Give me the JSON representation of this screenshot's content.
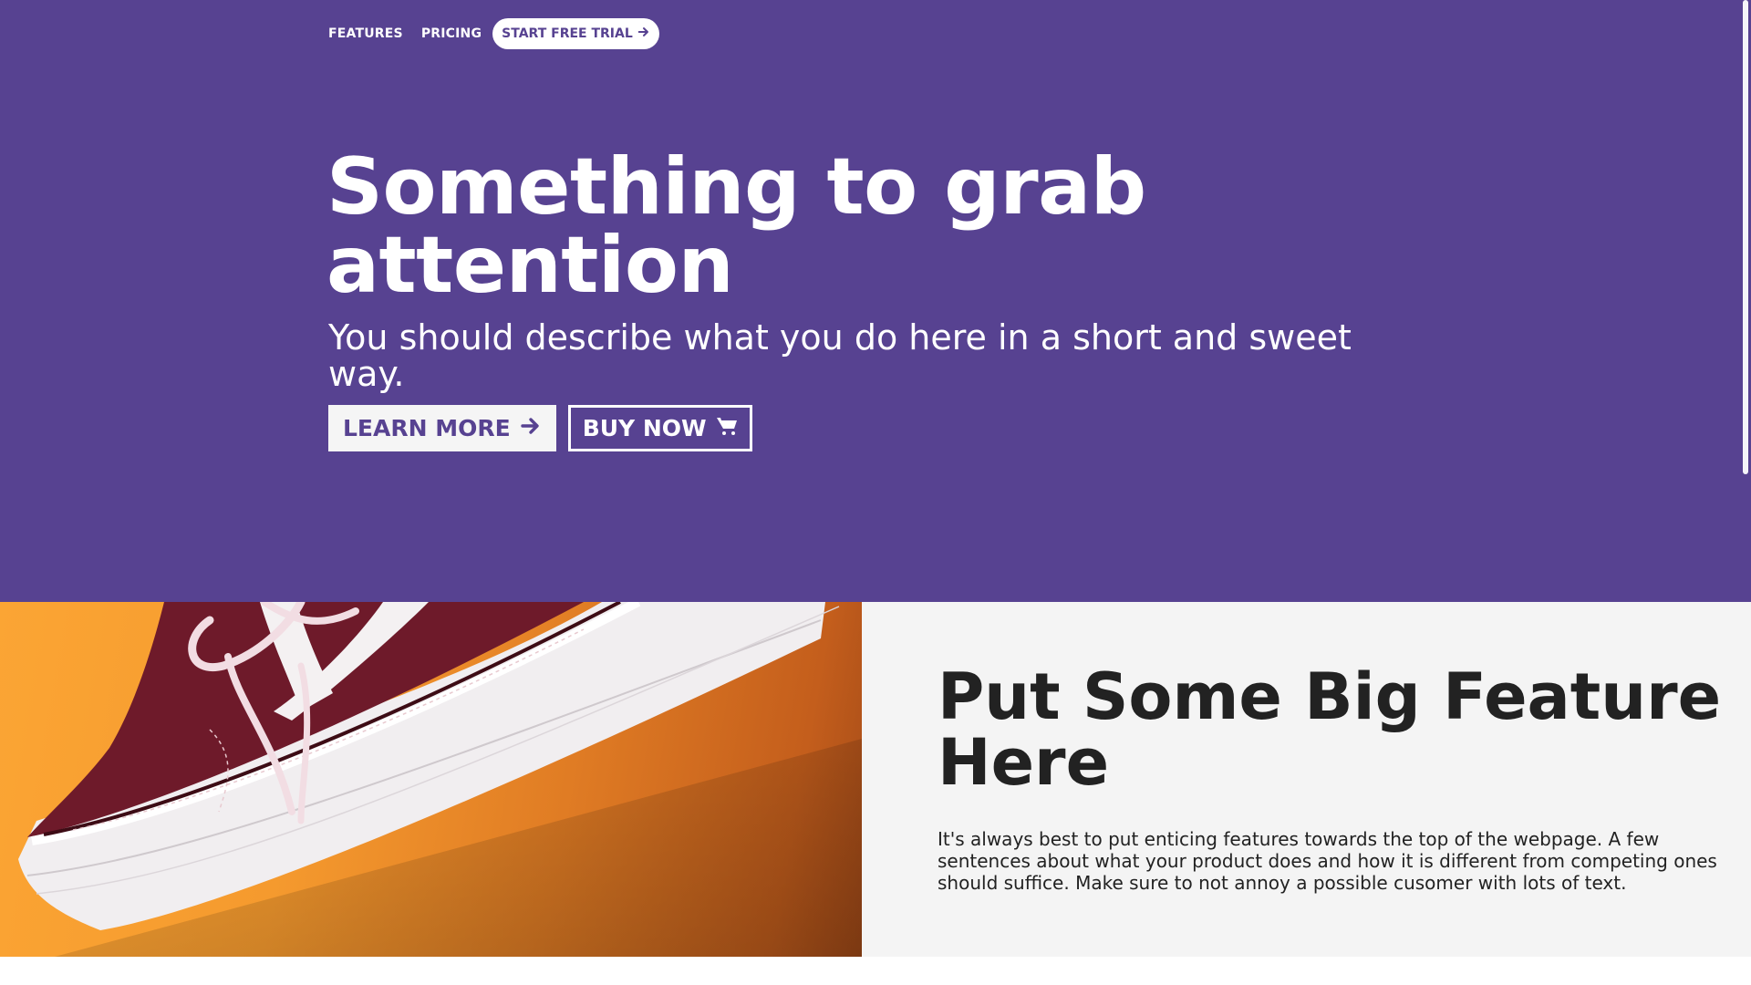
{
  "nav": {
    "features": "FEATURES",
    "pricing": "PRICING",
    "cta": "START FREE TRIAL",
    "cta_icon": "arrow-right-icon"
  },
  "hero": {
    "title": "Something to grab attention",
    "subtitle": "You should describe what you do here in a short and sweet way.",
    "learn_more": "LEARN MORE",
    "learn_more_icon": "arrow-right-icon",
    "buy_now": "BUY NOW",
    "buy_now_icon": "shopping-cart-icon"
  },
  "feature": {
    "title": "Put Some Big Feature Here",
    "text": "It's always best to put enticing features towards the top of the webpage. A few sentences about what your product does and how it is different from competing ones should suffice. Make sure to not annoy a possible cusomer with lots of text.",
    "image": "sneaker-photo"
  },
  "colors": {
    "primary": "#574291",
    "white": "#ffffff",
    "panel": "#f4f4f4",
    "text_dark": "#222222",
    "orange": "#f59a2e"
  }
}
